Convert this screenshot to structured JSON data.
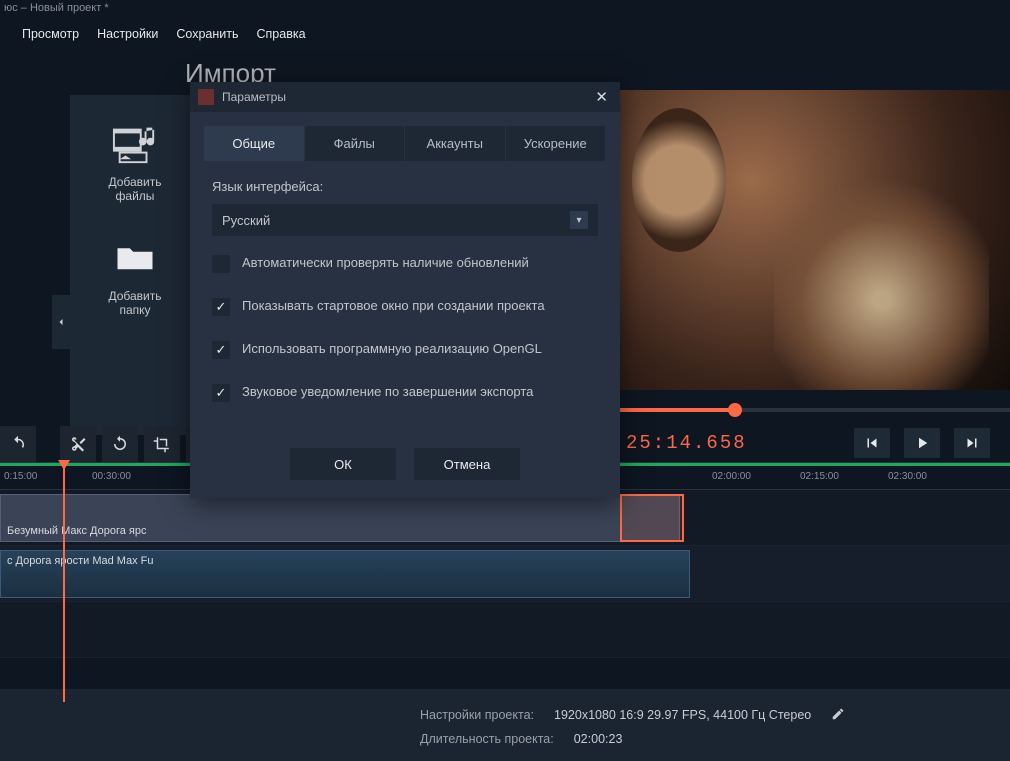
{
  "window_title": "юс – Новый проект *",
  "menu": {
    "view": "Просмотр",
    "settings": "Настройки",
    "save": "Сохранить",
    "help": "Справка"
  },
  "import": {
    "title": "Импорт",
    "add_files": "Добавить файлы",
    "add_folder": "Добавить папку"
  },
  "preview": {
    "timecode": "25:14.658"
  },
  "ruler": {
    "t1": "0:15:00",
    "t2": "00:30:00",
    "t3": "02:00:00",
    "t4": "02:15:00",
    "t5": "02:30:00"
  },
  "clips": {
    "video1": "Безумный Макс Дорога ярс",
    "audio1": "с Дорога ярости  Mad Max Fu"
  },
  "status": {
    "settings_label": "Настройки проекта:",
    "settings_val": "1920x1080 16:9 29.97 FPS, 44100 Гц Стерео",
    "duration_label": "Длительность проекта:",
    "duration_val": "02:00:23"
  },
  "modal": {
    "title": "Параметры",
    "tabs": {
      "general": "Общие",
      "files": "Файлы",
      "accounts": "Аккаунты",
      "accel": "Ускорение"
    },
    "lang_label": "Язык интерфейса:",
    "lang_selected": "Русский",
    "chk_updates": "Автоматически проверять наличие обновлений",
    "chk_startup": "Показывать стартовое окно при создании проекта",
    "chk_opengl": "Использовать программную реализацию OpenGL",
    "chk_sound": "Звуковое уведомление по завершении экспорта",
    "ok": "ОК",
    "cancel": "Отмена"
  }
}
